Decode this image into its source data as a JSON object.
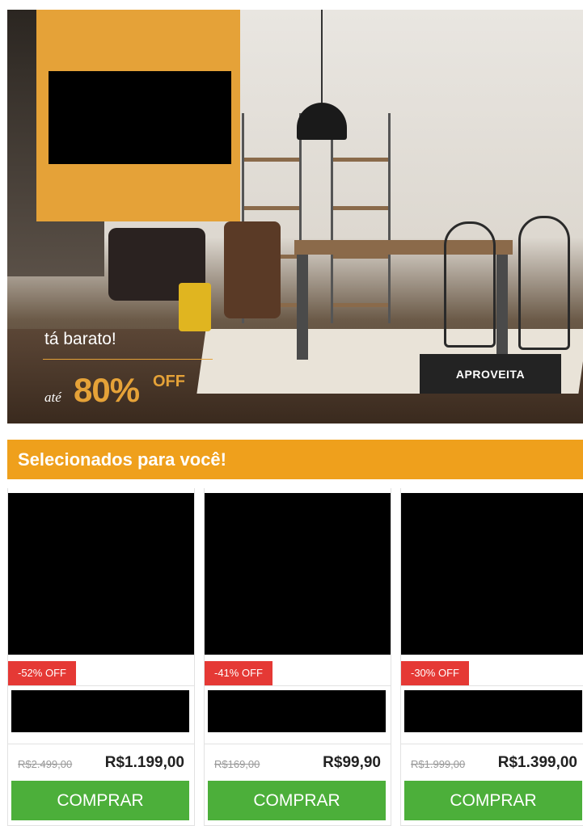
{
  "hero": {
    "tagline": "tá barato!",
    "prefix": "até",
    "discount": "80%",
    "off": "OFF",
    "cta": "APROVEITA"
  },
  "section": {
    "title": "Selecionados para você!"
  },
  "products": [
    {
      "badge": "-52% OFF",
      "old_price": "R$2.499,00",
      "price": "R$1.199,00",
      "cta": "COMPRAR"
    },
    {
      "badge": "-41% OFF",
      "old_price": "R$169,00",
      "price": "R$99,90",
      "cta": "COMPRAR"
    },
    {
      "badge": "-30% OFF",
      "old_price": "R$1.999,00",
      "price": "R$1.399,00",
      "cta": "COMPRAR"
    }
  ],
  "colors": {
    "accent_orange": "#efa01c",
    "hero_box": "#e5a238",
    "discount_red": "#e53935",
    "buy_green": "#4caf3a",
    "dark_button": "#232323"
  }
}
